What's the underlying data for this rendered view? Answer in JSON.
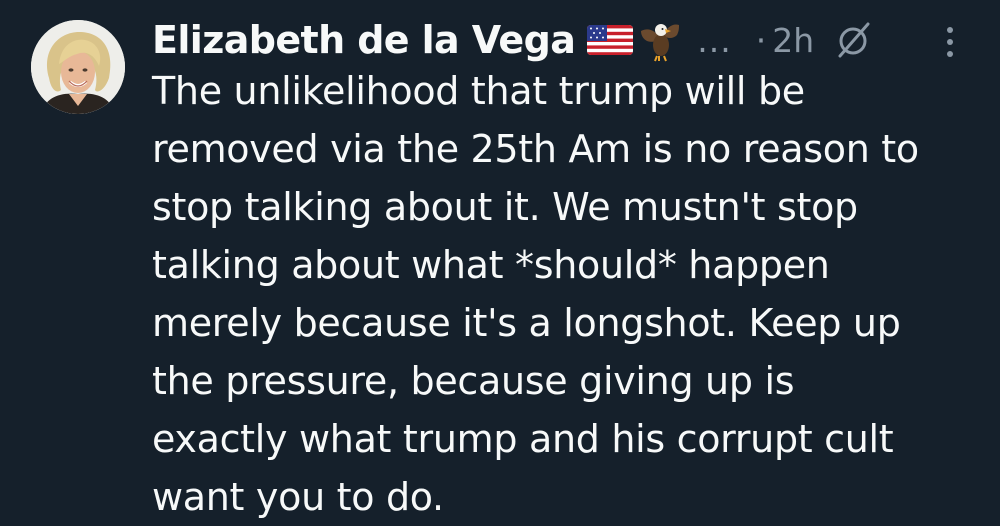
{
  "author": {
    "name": "Elizabeth de la Vega",
    "emojis": [
      "us-flag-emoji",
      "eagle-emoji"
    ],
    "avatar": "profile-photo"
  },
  "meta": {
    "ellipsis": "...",
    "separator": "·",
    "time": "2h"
  },
  "icons": {
    "grok": "grok-icon",
    "more": "more-options-icon"
  },
  "tweet": {
    "lines": [
      "The unlikelihood that trump will be",
      "removed via the 25th Am is no reason to",
      "stop talking about it. We mustn't stop",
      "talking about what *should* happen",
      "merely because it's a longshot. Keep up",
      "the pressure, because giving up is",
      "exactly what trump and his corrupt cult",
      "want you to do."
    ]
  },
  "colors": {
    "background": "#15202b",
    "text": "#f7f9f9",
    "secondary": "#8b98a5"
  }
}
